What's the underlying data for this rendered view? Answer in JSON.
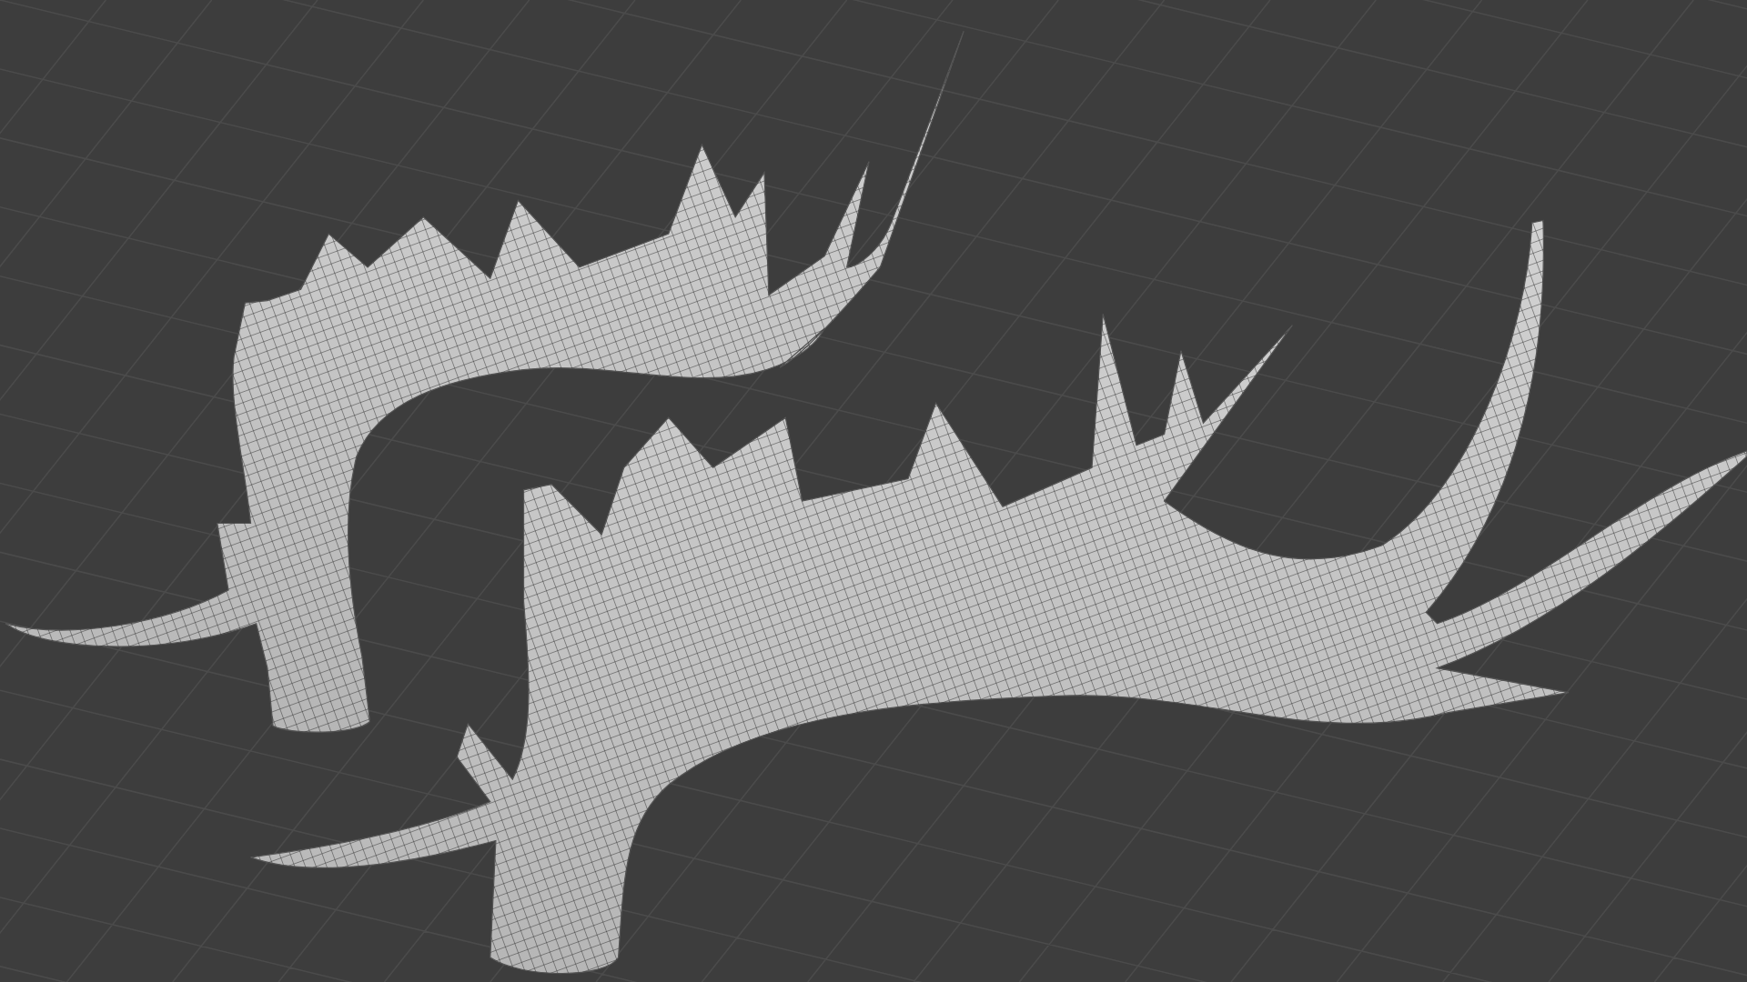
{
  "viewport": {
    "grid_floor": true,
    "wireframe_overlay": true
  }
}
